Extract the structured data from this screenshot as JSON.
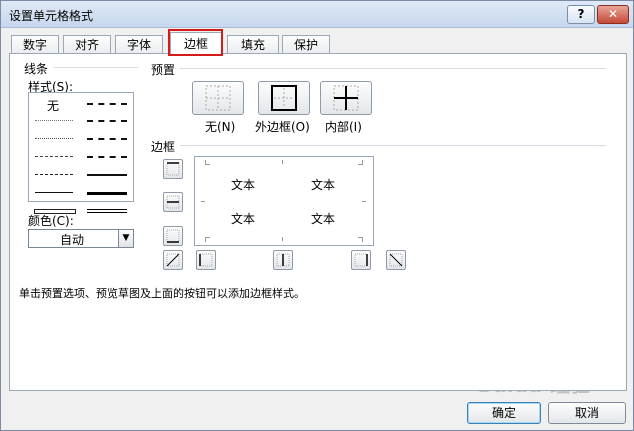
{
  "window": {
    "title": "设置单元格格式",
    "help_label": "?",
    "close_label": "✕"
  },
  "tabs": [
    "数字",
    "对齐",
    "字体",
    "边框",
    "填充",
    "保护"
  ],
  "active_tab": "边框",
  "highlight_color": "#d51a1a",
  "line_section": {
    "title": "线条",
    "style_label": "样式(S):",
    "none_label": "无",
    "color_label": "颜色(C):",
    "color_value": "自动"
  },
  "preset_section": {
    "title": "预置",
    "buttons": [
      {
        "label": "无(N)",
        "icon": "no-border-icon"
      },
      {
        "label": "外边框(O)",
        "icon": "outline-border-icon"
      },
      {
        "label": "内部(I)",
        "icon": "inside-border-icon"
      }
    ]
  },
  "border_section": {
    "title": "边框",
    "preview_text": [
      "文本",
      "文本",
      "文本",
      "文本"
    ],
    "border_buttons": [
      "top-border-icon",
      "middle-horizontal-border-icon",
      "bottom-border-icon",
      "diagonal-up-border-icon",
      "left-border-icon",
      "middle-vertical-border-icon",
      "right-border-icon",
      "diagonal-down-border-icon"
    ]
  },
  "hint_text": "单击预置选项、预览草图及上面的按钮可以添加边框样式。",
  "footer": {
    "ok_label": "确定",
    "cancel_label": "取消"
  },
  "watermark": "Baidu 经验"
}
